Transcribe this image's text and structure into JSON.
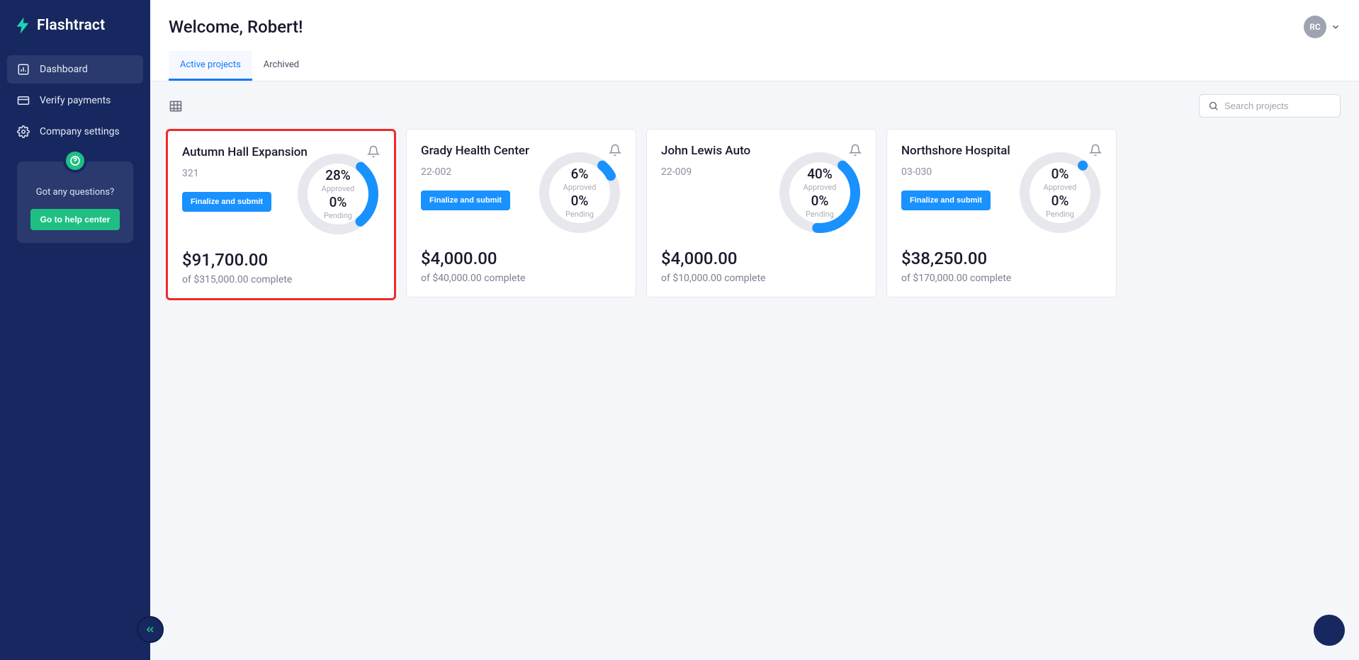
{
  "brand": "Flashtract",
  "user_initials": "RC",
  "welcome": "Welcome, Robert!",
  "sidebar": {
    "items": [
      {
        "label": "Dashboard"
      },
      {
        "label": "Verify payments"
      },
      {
        "label": "Company settings"
      }
    ]
  },
  "help": {
    "question": "Got any questions?",
    "button": "Go to help center"
  },
  "tabs": [
    {
      "label": "Active projects"
    },
    {
      "label": "Archived"
    }
  ],
  "search_placeholder": "Search projects",
  "finalize_label": "Finalize and submit",
  "approved_label": "Approved",
  "pending_label": "Pending",
  "of_word": "of",
  "complete_word": "complete",
  "chart_data": [
    {
      "type": "pie",
      "title": "Autumn Hall Expansion approval",
      "categories": [
        "Approved",
        "Pending",
        "Remaining"
      ],
      "values": [
        28,
        0,
        72
      ]
    },
    {
      "type": "pie",
      "title": "Grady Health Center approval",
      "categories": [
        "Approved",
        "Pending",
        "Remaining"
      ],
      "values": [
        6,
        0,
        94
      ]
    },
    {
      "type": "pie",
      "title": "John Lewis Auto approval",
      "categories": [
        "Approved",
        "Pending",
        "Remaining"
      ],
      "values": [
        40,
        0,
        60
      ]
    },
    {
      "type": "pie",
      "title": "Northshore Hospital approval",
      "categories": [
        "Approved",
        "Pending",
        "Remaining"
      ],
      "values": [
        0,
        0,
        100
      ]
    }
  ],
  "projects": [
    {
      "name": "Autumn Hall Expansion",
      "code": "321",
      "approved_pct": "28%",
      "pending_pct": "0%",
      "approved_num": 28,
      "amount": "$91,700.00",
      "total": "$315,000.00",
      "highlighted": true,
      "show_finalize": true
    },
    {
      "name": "Grady Health Center",
      "code": "22-002",
      "approved_pct": "6%",
      "pending_pct": "0%",
      "approved_num": 6,
      "amount": "$4,000.00",
      "total": "$40,000.00",
      "highlighted": false,
      "show_finalize": true
    },
    {
      "name": "John Lewis Auto",
      "code": "22-009",
      "approved_pct": "40%",
      "pending_pct": "0%",
      "approved_num": 40,
      "amount": "$4,000.00",
      "total": "$10,000.00",
      "highlighted": false,
      "show_finalize": false
    },
    {
      "name": "Northshore Hospital",
      "code": "03-030",
      "approved_pct": "0%",
      "pending_pct": "0%",
      "approved_num": 0,
      "amount": "$38,250.00",
      "total": "$170,000.00",
      "highlighted": false,
      "show_finalize": true
    }
  ]
}
